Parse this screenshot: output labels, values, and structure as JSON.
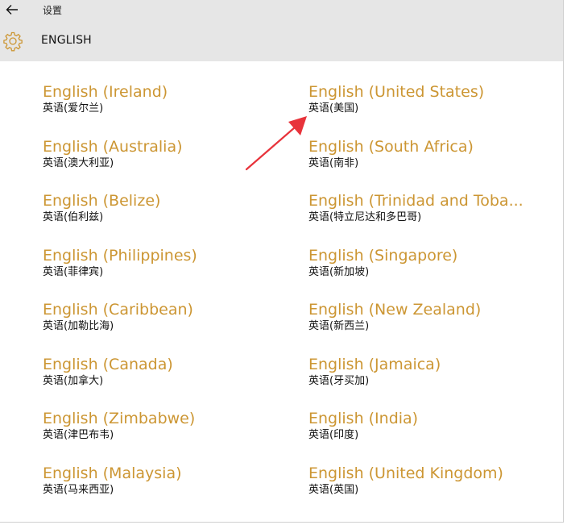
{
  "window": {
    "title": "设置"
  },
  "header": {
    "title": "ENGLISH",
    "icon": "gear-icon"
  },
  "colors": {
    "accent": "#cc9633",
    "chrome": "#e6e6e6",
    "annotation": "#e8333b"
  },
  "languages_left": [
    {
      "name": "English (Ireland)",
      "native": "英语(爱尔兰)"
    },
    {
      "name": "English (Australia)",
      "native": "英语(澳大利亚)"
    },
    {
      "name": "English (Belize)",
      "native": "英语(伯利兹)"
    },
    {
      "name": "English (Philippines)",
      "native": "英语(菲律宾)"
    },
    {
      "name": "English (Caribbean)",
      "native": "英语(加勒比海)"
    },
    {
      "name": "English (Canada)",
      "native": "英语(加拿大)"
    },
    {
      "name": "English (Zimbabwe)",
      "native": "英语(津巴布韦)"
    },
    {
      "name": "English (Malaysia)",
      "native": "英语(马来西亚)"
    }
  ],
  "languages_right": [
    {
      "name": "English (United States)",
      "native": "英语(美国)"
    },
    {
      "name": "English (South Africa)",
      "native": "英语(南非)"
    },
    {
      "name": "English (Trinidad and Toba...",
      "native": "英语(特立尼达和多巴哥)"
    },
    {
      "name": "English (Singapore)",
      "native": "英语(新加坡)"
    },
    {
      "name": "English (New Zealand)",
      "native": "英语(新西兰)"
    },
    {
      "name": "English (Jamaica)",
      "native": "英语(牙买加)"
    },
    {
      "name": "English (India)",
      "native": "英语(印度)"
    },
    {
      "name": "English (United Kingdom)",
      "native": "英语(英国)"
    }
  ]
}
